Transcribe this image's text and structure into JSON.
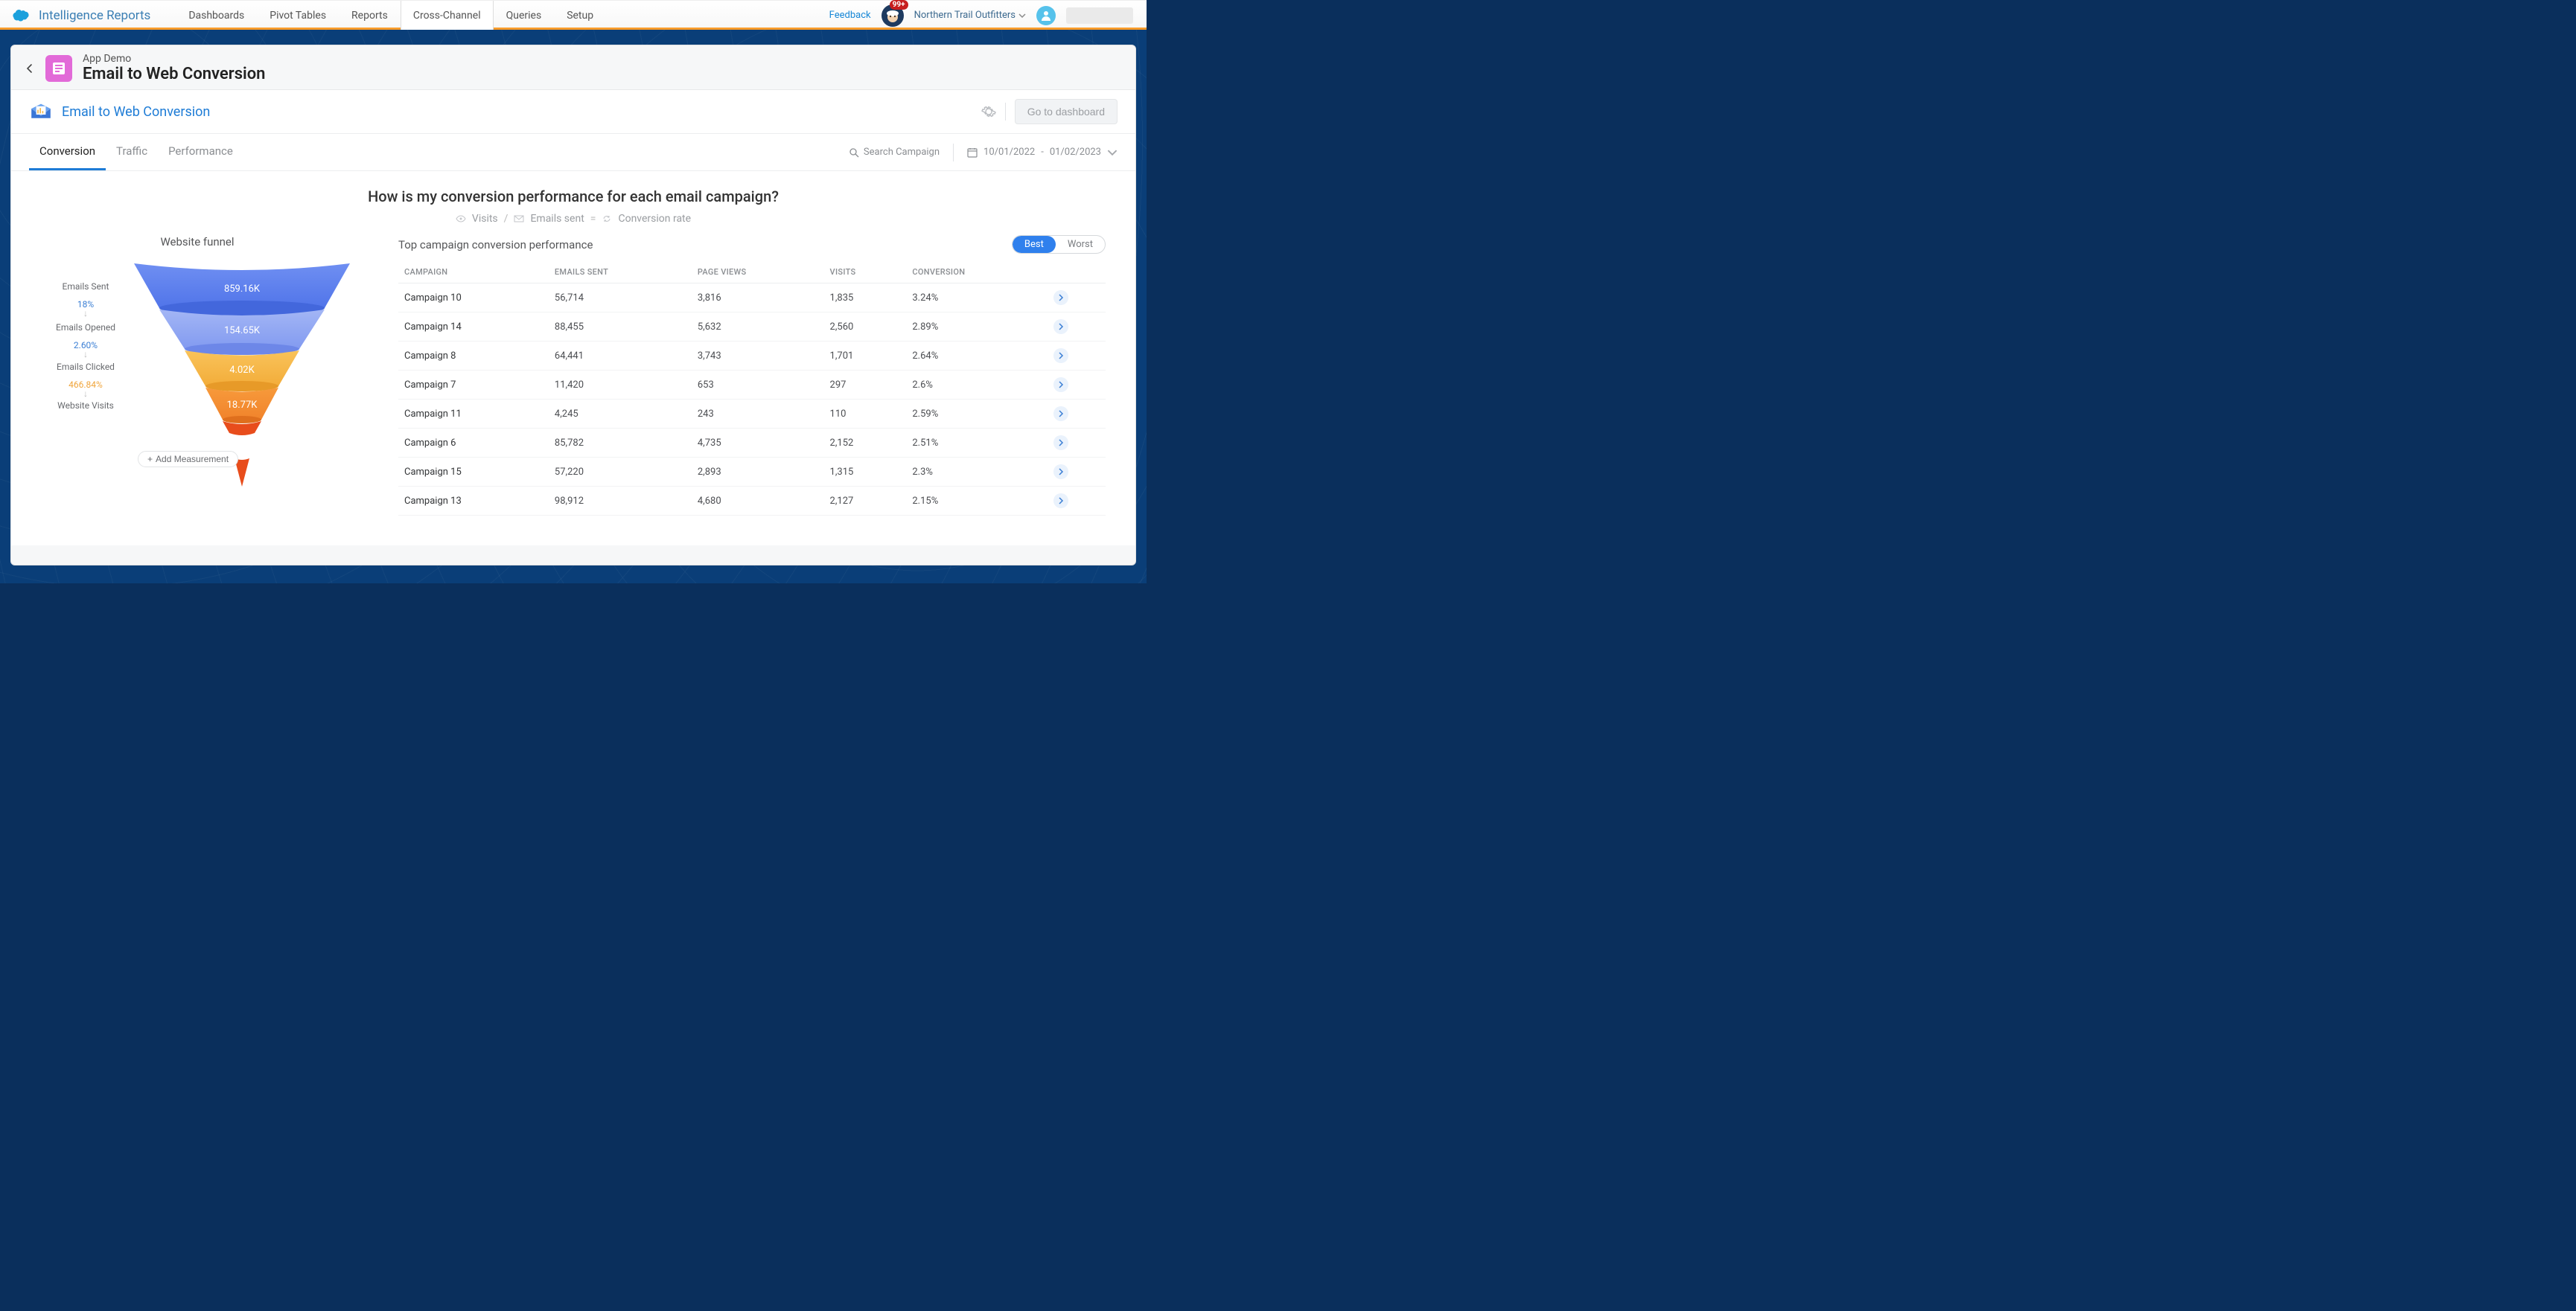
{
  "brand": "Intelligence Reports",
  "topnav": {
    "tabs": [
      "Dashboards",
      "Pivot Tables",
      "Reports",
      "Cross-Channel",
      "Queries",
      "Setup"
    ],
    "active": "Cross-Channel"
  },
  "feedback": "Feedback",
  "notif_badge": "99+",
  "org": "Northern Trail Outfitters",
  "breadcrumb": "App Demo",
  "page_title": "Email to Web Conversion",
  "page_header": "Email to Web Conversion",
  "godash": "Go to dashboard",
  "tabs": {
    "items": [
      "Conversion",
      "Traffic",
      "Performance"
    ],
    "active": "Conversion"
  },
  "search_label": "Search Campaign",
  "daterange": {
    "from": "10/01/2022",
    "sep": "-",
    "to": "01/02/2023"
  },
  "question": "How is my conversion performance for each email campaign?",
  "formula": {
    "a": "Visits",
    "b": "Emails sent",
    "c": "Conversion rate"
  },
  "funnel": {
    "title": "Website funnel",
    "addm": "Add Measurement",
    "stages": [
      {
        "label": "Emails Sent",
        "value": "859.16K",
        "rate": "18%",
        "rate_color": "#3b7fd4"
      },
      {
        "label": "Emails Opened",
        "value": "154.65K",
        "rate": "2.60%",
        "rate_color": "#3b7fd4"
      },
      {
        "label": "Emails Clicked",
        "value": "4.02K",
        "rate": "466.84%",
        "rate_color": "#f0a53b"
      },
      {
        "label": "Website Visits",
        "value": "18.77K",
        "rate": "",
        "rate_color": ""
      }
    ]
  },
  "toggle": {
    "best": "Best",
    "worst": "Worst",
    "active": "Best"
  },
  "table": {
    "title": "Top campaign conversion performance",
    "headers": [
      "CAMPAIGN",
      "EMAILS SENT",
      "PAGE VIEWS",
      "VISITS",
      "CONVERSION"
    ],
    "rows": [
      {
        "c": "Campaign 10",
        "es": "56,714",
        "pv": "3,816",
        "v": "1,835",
        "cv": "3.24%"
      },
      {
        "c": "Campaign 14",
        "es": "88,455",
        "pv": "5,632",
        "v": "2,560",
        "cv": "2.89%"
      },
      {
        "c": "Campaign 8",
        "es": "64,441",
        "pv": "3,743",
        "v": "1,701",
        "cv": "2.64%"
      },
      {
        "c": "Campaign 7",
        "es": "11,420",
        "pv": "653",
        "v": "297",
        "cv": "2.6%"
      },
      {
        "c": "Campaign 11",
        "es": "4,245",
        "pv": "243",
        "v": "110",
        "cv": "2.59%"
      },
      {
        "c": "Campaign 6",
        "es": "85,782",
        "pv": "4,735",
        "v": "2,152",
        "cv": "2.51%"
      },
      {
        "c": "Campaign 15",
        "es": "57,220",
        "pv": "2,893",
        "v": "1,315",
        "cv": "2.3%"
      },
      {
        "c": "Campaign 13",
        "es": "98,912",
        "pv": "4,680",
        "v": "2,127",
        "cv": "2.15%"
      }
    ]
  },
  "chart_data": {
    "type": "funnel",
    "title": "Website funnel",
    "stages": [
      {
        "name": "Emails Sent",
        "value": 859160,
        "display": "859.16K",
        "drop_to_next_pct": 18.0
      },
      {
        "name": "Emails Opened",
        "value": 154650,
        "display": "154.65K",
        "drop_to_next_pct": 2.6
      },
      {
        "name": "Emails Clicked",
        "value": 4020,
        "display": "4.02K",
        "drop_to_next_pct": 466.84
      },
      {
        "name": "Website Visits",
        "value": 18770,
        "display": "18.77K"
      }
    ],
    "colors": [
      "#5b7ff0",
      "#8aa4f3",
      "#f5b747",
      "#f58f2f",
      "#e84d1c"
    ]
  }
}
